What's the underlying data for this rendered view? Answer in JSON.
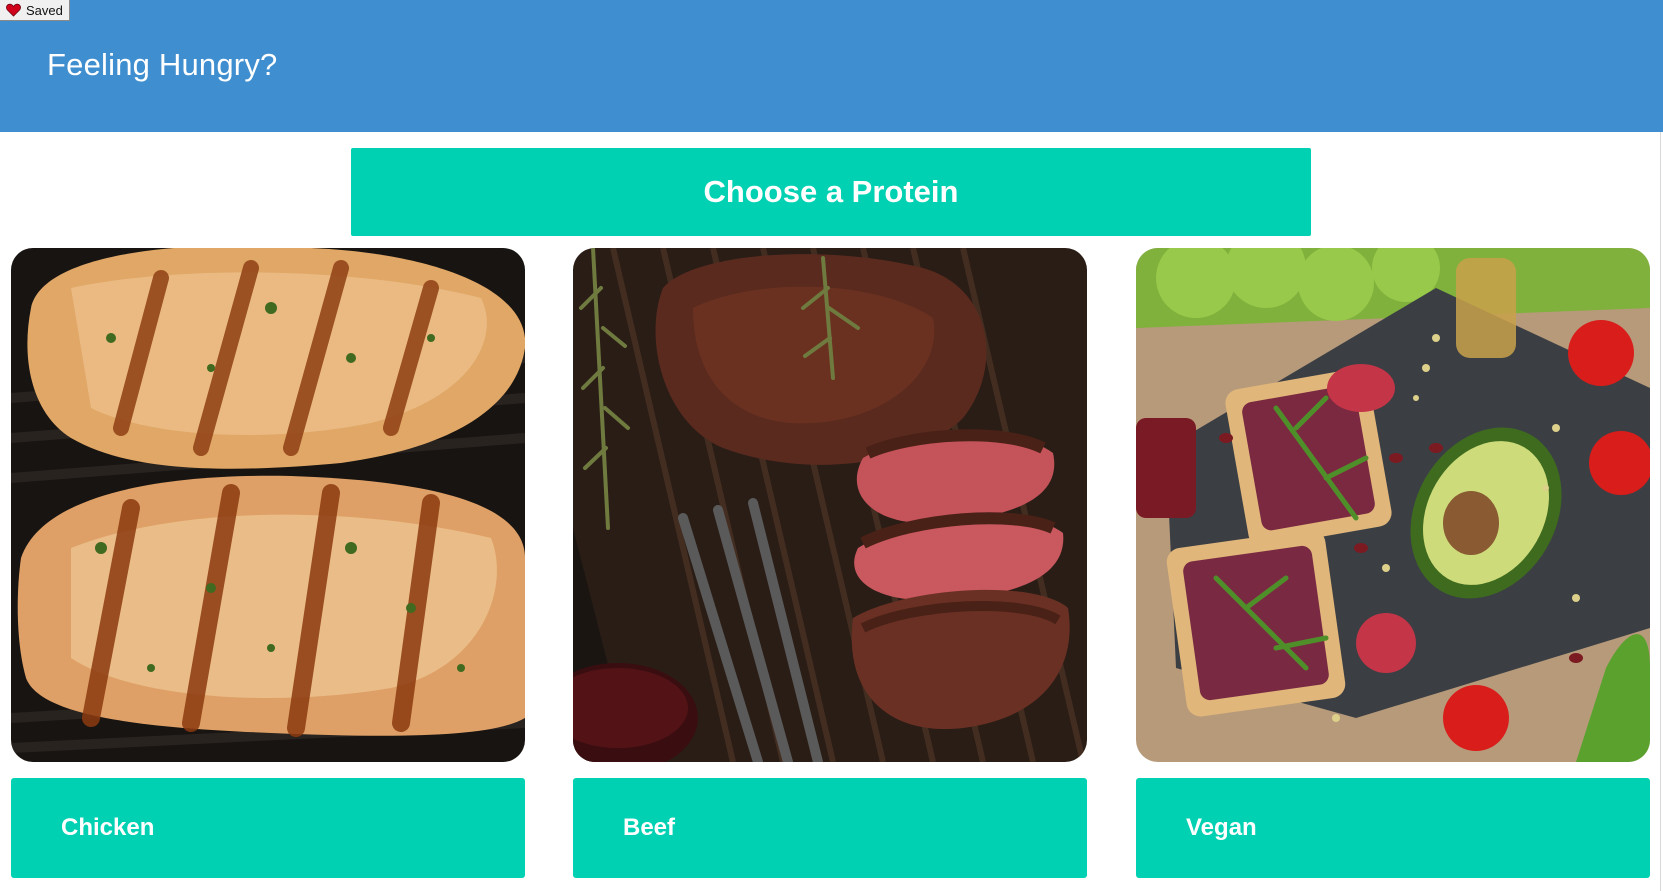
{
  "saved_badge": {
    "label": "Saved",
    "icon": "heart-icon",
    "icon_color": "#d0021b"
  },
  "header": {
    "title": "Feeling Hungry?",
    "background": "#3f8ecf"
  },
  "banner": {
    "title": "Choose a Protein",
    "background": "#00d1b2"
  },
  "cards": [
    {
      "label": "Chicken",
      "image": "grilled-chicken-image"
    },
    {
      "label": "Beef",
      "image": "sliced-steak-image"
    },
    {
      "label": "Vegan",
      "image": "vegan-toast-image"
    }
  ]
}
